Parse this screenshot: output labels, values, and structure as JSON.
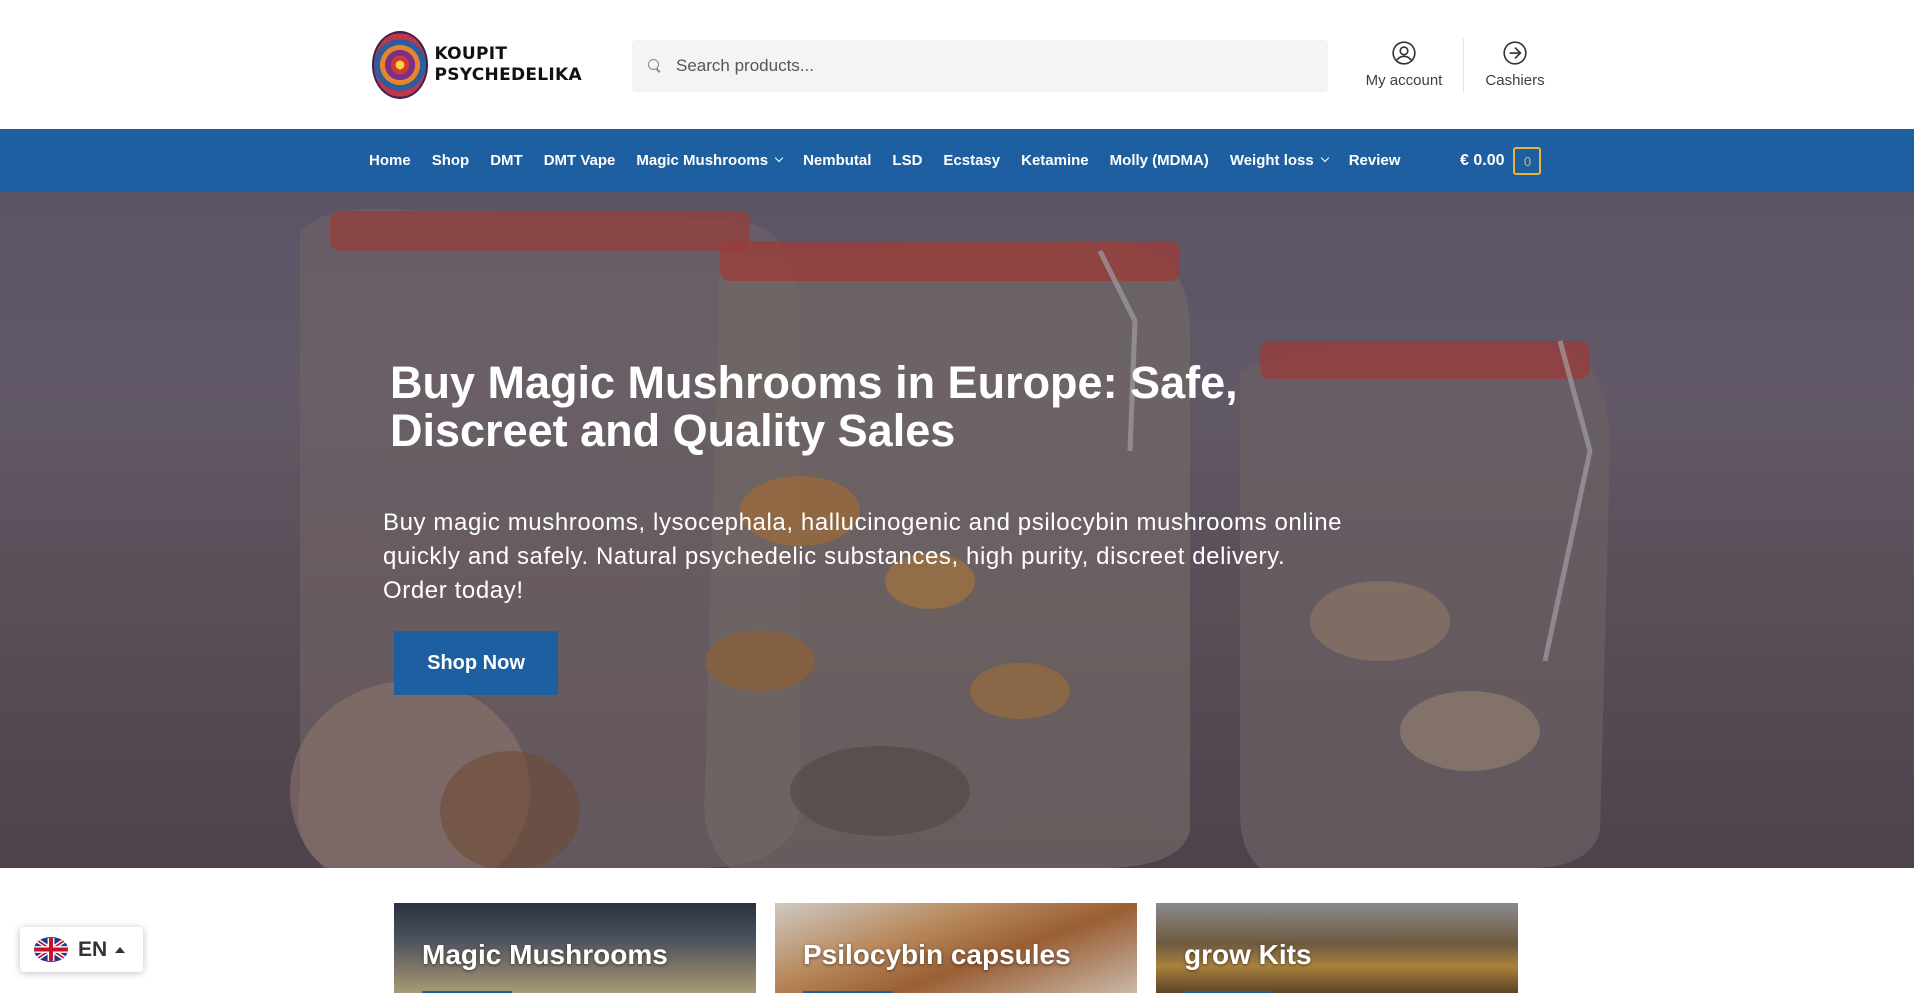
{
  "header": {
    "logo_line1": "KOUPIT",
    "logo_line2": "PSYCHEDELIKA",
    "search_placeholder": "Search products...",
    "account_label": "My account",
    "cashiers_label": "Cashiers"
  },
  "nav": {
    "items": [
      {
        "label": "Home",
        "dropdown": false
      },
      {
        "label": "Shop",
        "dropdown": false
      },
      {
        "label": "DMT",
        "dropdown": false
      },
      {
        "label": "DMT Vape",
        "dropdown": false
      },
      {
        "label": "Magic Mushrooms",
        "dropdown": true
      },
      {
        "label": "Nembutal",
        "dropdown": false
      },
      {
        "label": "LSD",
        "dropdown": false
      },
      {
        "label": "Ecstasy",
        "dropdown": false
      },
      {
        "label": "Ketamine",
        "dropdown": false
      },
      {
        "label": "Molly (MDMA)",
        "dropdown": false
      },
      {
        "label": "Weight loss",
        "dropdown": true
      },
      {
        "label": "Review",
        "dropdown": false
      }
    ],
    "cart_amount": "€ 0.00",
    "cart_count": "0"
  },
  "hero": {
    "title": "Buy Magic Mushrooms in Europe: Safe, Discreet and Quality Sales",
    "subtitle": "Buy magic mushrooms, lysocephala, hallucinogenic and psilocybin mushrooms online quickly and safely. Natural psychedelic substances, high purity, discreet delivery. Order today!",
    "button_label": "Shop Now"
  },
  "cards": [
    {
      "label": "Magic Mushrooms"
    },
    {
      "label": "Psilocybin capsules"
    },
    {
      "label": "grow Kits"
    }
  ],
  "language": {
    "code": "EN"
  },
  "colors": {
    "primary": "#1d5fa0",
    "cart_accent": "#e7b63a"
  }
}
